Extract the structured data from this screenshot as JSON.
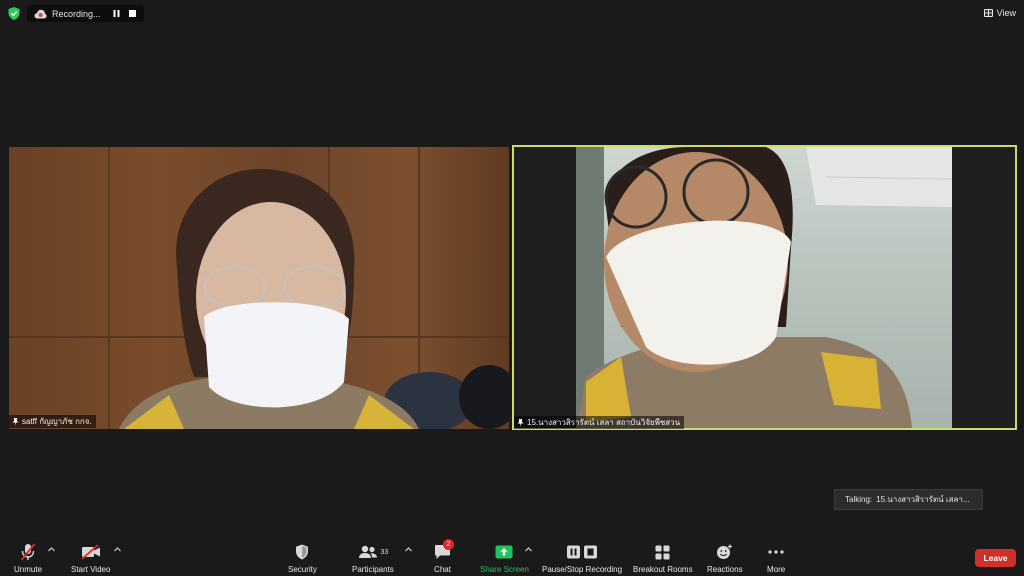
{
  "top_bar": {
    "recording_label": "Recording...",
    "view_label": "View"
  },
  "participants_video": [
    {
      "name": "satff กัญญาภัช กกจ."
    },
    {
      "name": "15.นางสาวสิรารัตน์ เสลา สถาบันวิจัยพืชสวน"
    }
  ],
  "talking": {
    "label": "Talking:",
    "name": "15.นางสาวสิรารัตน์ เสลา..."
  },
  "toolbar": {
    "unmute": "Unmute",
    "start_video": "Start Video",
    "security": "Security",
    "participants": "Participants",
    "participants_count": "33",
    "chat": "Chat",
    "chat_badge": "2",
    "share_screen": "Share Screen",
    "pause_stop_recording": "Pause/Stop Recording",
    "breakout_rooms": "Breakout Rooms",
    "reactions": "Reactions",
    "more": "More",
    "leave": "Leave"
  },
  "colors": {
    "background": "#1a1a1a",
    "active_speaker_border": "#c9dd6b",
    "share_green": "#22c35e",
    "leave_red": "#d0302a",
    "badge_red": "#e02828"
  }
}
